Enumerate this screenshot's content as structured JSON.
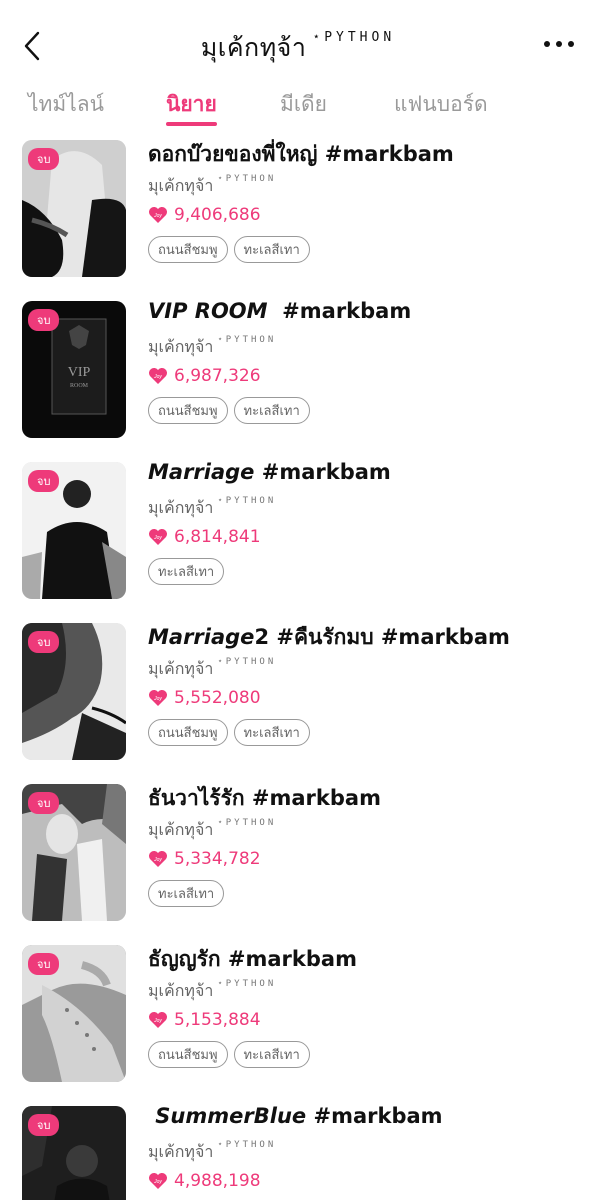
{
  "header": {
    "title": "มุเค้กทุจ้า",
    "tag": "⋆PYTHON",
    "back_icon": "chevron-left-icon",
    "more_icon": "more-dots-icon"
  },
  "tabs": [
    {
      "label": "ไทม์ไลน์",
      "active": false
    },
    {
      "label": "นิยาย",
      "active": true
    },
    {
      "label": "มีเดีย",
      "active": false
    },
    {
      "label": "แฟนบอร์ด",
      "active": false
    }
  ],
  "accent_color": "#ee3a7a",
  "novels": [
    {
      "badge": "จบ",
      "title_italic": "",
      "title": "ดอกบ๊วยของพี่ใหญ่ #markbam",
      "author": "มุเค้กทุจ้า",
      "author_tag": "⋆PYTHON",
      "views": "9,406,686",
      "tags": [
        "ถนนสีชมพู",
        "ทะเลสีเทา"
      ]
    },
    {
      "badge": "จบ",
      "title_italic": "VIP ROOM",
      "title": "  #markbam",
      "author": "มุเค้กทุจ้า",
      "author_tag": "⋆PYTHON",
      "views": "6,987,326",
      "tags": [
        "ถนนสีชมพู",
        "ทะเลสีเทา"
      ],
      "cover_text_1": "VIP",
      "cover_text_2": "ROOM"
    },
    {
      "badge": "จบ",
      "title_italic": "Marriage",
      "title": " #markbam",
      "author": "มุเค้กทุจ้า",
      "author_tag": "⋆PYTHON",
      "views": "6,814,841",
      "tags": [
        "ทะเลสีเทา"
      ]
    },
    {
      "badge": "จบ",
      "title_italic": "Marriage",
      "title": "2 #คืนรักมบ #markbam",
      "author": "มุเค้กทุจ้า",
      "author_tag": "⋆PYTHON",
      "views": "5,552,080",
      "tags": [
        "ถนนสีชมพู",
        "ทะเลสีเทา"
      ]
    },
    {
      "badge": "จบ",
      "title_italic": "",
      "title": "ธันวาไร้รัก #markbam",
      "author": "มุเค้กทุจ้า",
      "author_tag": "⋆PYTHON",
      "views": "5,334,782",
      "tags": [
        "ทะเลสีเทา"
      ]
    },
    {
      "badge": "จบ",
      "title_italic": "",
      "title": "ธัญญรัก #markbam",
      "author": "มุเค้กทุจ้า",
      "author_tag": "⋆PYTHON",
      "views": "5,153,884",
      "tags": [
        "ถนนสีชมพู",
        "ทะเลสีเทา"
      ]
    },
    {
      "badge": "จบ",
      "title_italic": " SummerBlue",
      "title": " #markbam",
      "author": "มุเค้กทุจ้า",
      "author_tag": "⋆PYTHON",
      "views": "4,988,198",
      "tags": []
    }
  ]
}
